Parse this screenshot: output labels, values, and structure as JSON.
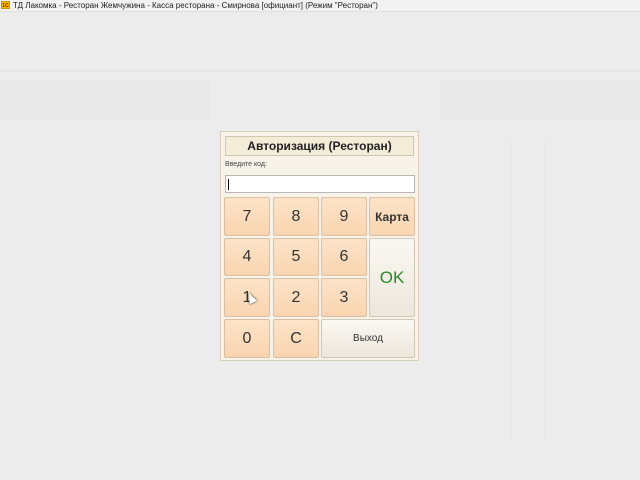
{
  "window": {
    "title": "ТД Лакомка  - Ресторан Жемчужина - Касса ресторана - Смирнова [официант] (Режим \"Ресторан\")",
    "icon": "app-1c-icon"
  },
  "dialog": {
    "title": "Авторизация (Ресторан)",
    "code_label": "Введите код:",
    "code_value": ""
  },
  "keypad": {
    "k7": "7",
    "k8": "8",
    "k9": "9",
    "card": "Карта",
    "k4": "4",
    "k5": "5",
    "k6": "6",
    "ok": "OK",
    "k1": "1",
    "k2": "2",
    "k3": "3",
    "k0": "0",
    "clear": "C",
    "exit": "Выход"
  },
  "colors": {
    "key_fill": "#fbdcbc",
    "ok_text": "#2a8a2a",
    "dialog_bg": "#f7f3e8"
  }
}
